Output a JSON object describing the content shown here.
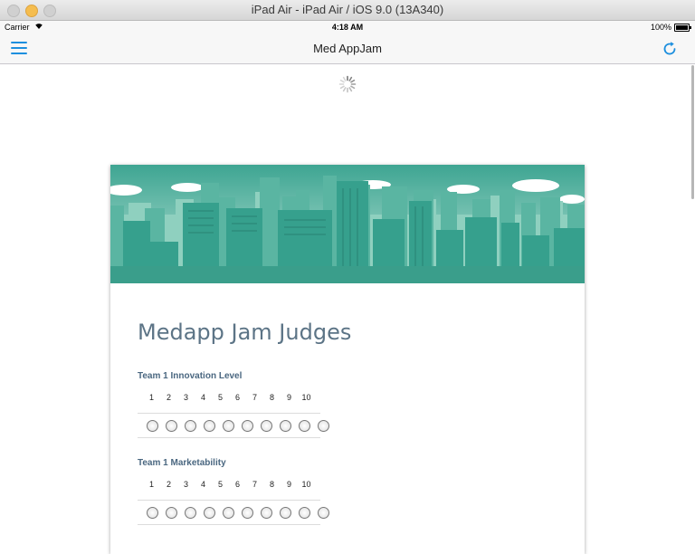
{
  "window": {
    "title": "iPad Air - iPad Air / iOS 9.0 (13A340)"
  },
  "status": {
    "carrier": "Carrier",
    "time": "4:18 AM",
    "battery": "100%"
  },
  "nav": {
    "title": "Med AppJam",
    "menu_icon": "hamburger-menu-icon",
    "refresh_icon": "refresh-icon"
  },
  "form": {
    "title": "Medapp Jam Judges",
    "questions": [
      {
        "label": "Team 1 Innovation Level",
        "scale": [
          "1",
          "2",
          "3",
          "4",
          "5",
          "6",
          "7",
          "8",
          "9",
          "10"
        ]
      },
      {
        "label": "Team 1 Marketability",
        "scale": [
          "1",
          "2",
          "3",
          "4",
          "5",
          "6",
          "7",
          "8",
          "9",
          "10"
        ]
      }
    ]
  },
  "colors": {
    "accent": "#1d8fde",
    "banner": "#3aa392",
    "title": "#5c7486"
  }
}
